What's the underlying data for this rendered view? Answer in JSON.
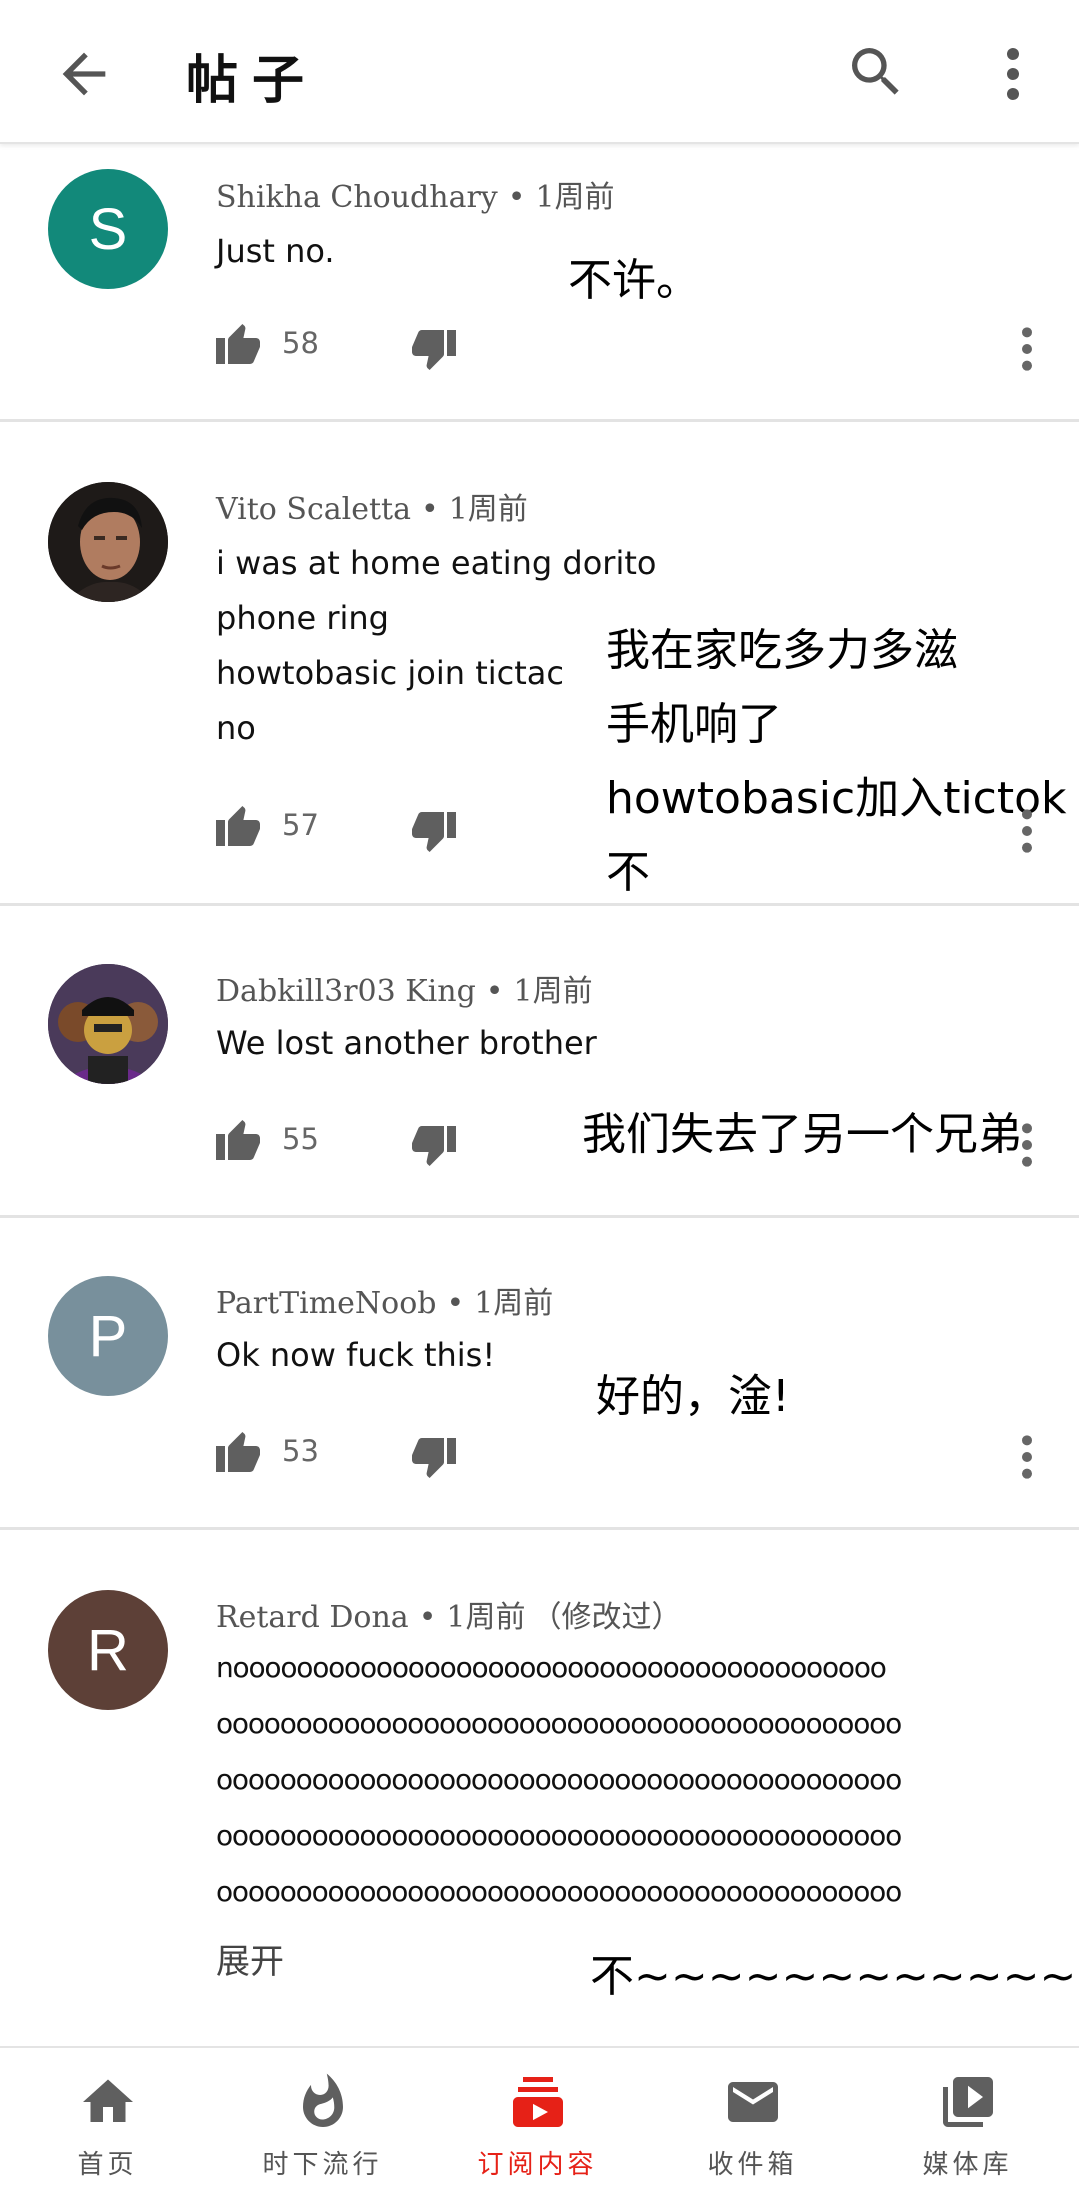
{
  "header": {
    "title": "帖子",
    "back_icon": "arrow-back-icon",
    "search_icon": "search-icon",
    "more_icon": "more-vert-icon"
  },
  "comments": [
    {
      "author": "Shikha Choudhary",
      "time": "1周前",
      "text": "Just no.",
      "translation": "不许。",
      "likes": "58",
      "avatar": {
        "type": "letter",
        "letter": "S",
        "color": "#12897a"
      }
    },
    {
      "author": "Vito Scaletta",
      "time": "1周前",
      "text": "i was at home eating dorito\nphone ring\nhowtobasic join tictac\nno",
      "translation": "我在家吃多力多滋\n手机响了\nhowtobasic加入tictok\n不",
      "likes": "57",
      "avatar": {
        "type": "photo",
        "icon": "man-portrait-avatar"
      }
    },
    {
      "author": "Dabkill3r03 King",
      "time": "1周前",
      "text": "We lost another brother",
      "translation": "我们失去了另一个兄弟",
      "likes": "55",
      "avatar": {
        "type": "photo",
        "icon": "cartoon-group-avatar"
      }
    },
    {
      "author": "PartTimeNoob",
      "time": "1周前",
      "text": "Ok now fuck this!",
      "translation": "好的，淦!",
      "likes": "53",
      "avatar": {
        "type": "letter",
        "letter": "P",
        "color": "#78909c"
      }
    },
    {
      "author": "Retard Dona",
      "time": "1周前",
      "edited": "（修改过）",
      "text": "nooooooooooooooooooooooooooooooooooooooooo\nooooooooooooooooooooooooooooooooooooooooooo\nooooooooooooooooooooooooooooooooooooooooooo\nooooooooooooooooooooooooooooooooooooooooooo\nooooooooooooooooooooooooooooooooooooooooooo",
      "expand": "展开",
      "translation": "不~~~~~~~~~~~~",
      "avatar": {
        "type": "letter",
        "letter": "R",
        "color": "#5d4037"
      }
    }
  ],
  "bottom_nav": [
    {
      "label": "首页",
      "icon": "home-icon"
    },
    {
      "label": "时下流行",
      "icon": "trending-flame-icon"
    },
    {
      "label": "订阅内容",
      "icon": "subscriptions-icon",
      "active": true
    },
    {
      "label": "收件箱",
      "icon": "inbox-mail-icon"
    },
    {
      "label": "媒体库",
      "icon": "library-icon"
    }
  ],
  "colors": {
    "accent": "#e62117",
    "icon_gray": "#5f5f5f",
    "divider": "#e3e3e3"
  }
}
